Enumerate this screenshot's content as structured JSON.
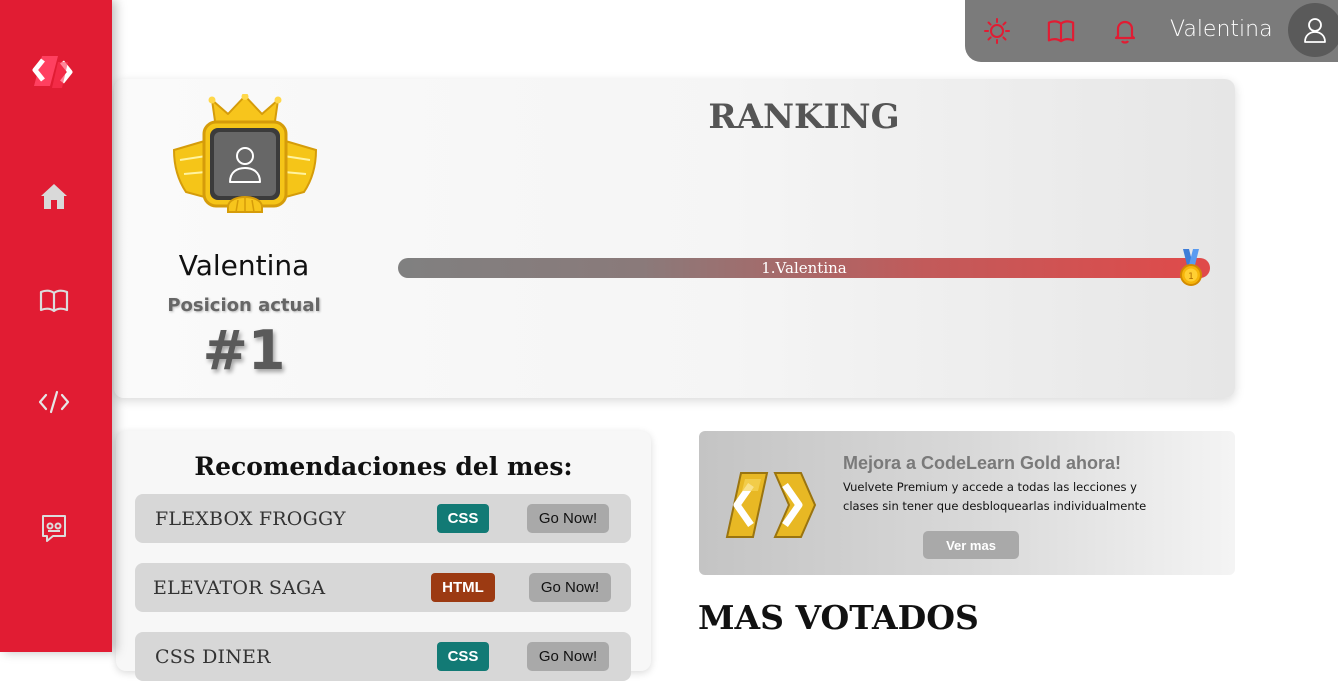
{
  "sidebar": {
    "logo_name": "codelearn-logo",
    "items": [
      {
        "icon": "home-icon"
      },
      {
        "icon": "book-icon"
      },
      {
        "icon": "code-icon"
      },
      {
        "icon": "chat-icon"
      }
    ]
  },
  "topbar": {
    "icons": [
      "sun-icon",
      "book-icon",
      "bell-icon"
    ],
    "username": "Valentina"
  },
  "ranking": {
    "title": "RANKING",
    "profile_name": "Valentina",
    "position_label": "Posicion actual",
    "position_value": "#1",
    "bar_entries": [
      {
        "label": "1.Valentina",
        "progress": 1.0
      }
    ]
  },
  "recommendations": {
    "title": "Recomendaciones del mes:",
    "items": [
      {
        "name": "FLEXBOX FROGGY",
        "tag": "CSS",
        "tag_color": "#127a75",
        "action": "Go Now!"
      },
      {
        "name": "ELEVATOR SAGA",
        "tag": "HTML",
        "tag_color": "#9c3a12",
        "action": "Go Now!"
      },
      {
        "name": "CSS DINER",
        "tag": "CSS",
        "tag_color": "#127a75",
        "action": "Go Now!"
      }
    ]
  },
  "promo": {
    "title": "Mejora a CodeLearn Gold ahora!",
    "text": "Vuelvete Premium y accede a todas las lecciones y clases sin tener que desbloquearlas individualmente",
    "button": "Ver mas"
  },
  "most_voted": {
    "title": "MAS VOTADOS"
  },
  "colors": {
    "brand_red": "#e11c33",
    "topbar_gray": "#7b7b7b",
    "css_tag": "#127a75",
    "html_tag": "#9c3a12",
    "gold": "#f5c518"
  }
}
